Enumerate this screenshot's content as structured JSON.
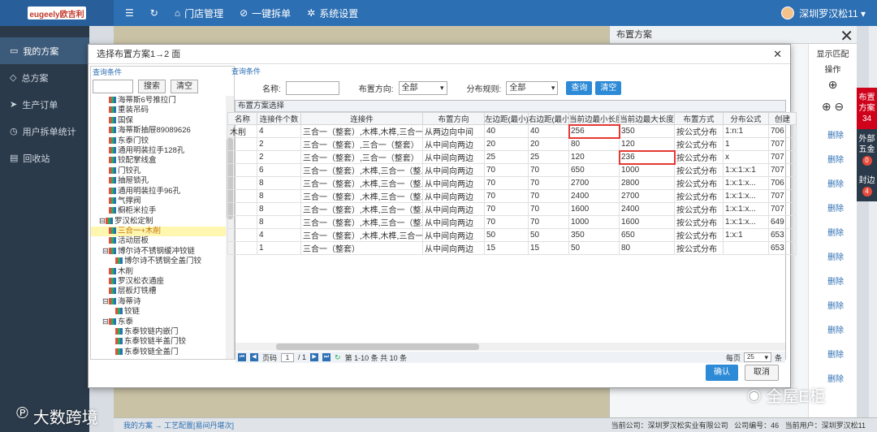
{
  "app": {
    "logo_text": "eugeely欧吉利",
    "nav": [
      {
        "label": "门店管理",
        "icon": "home-icon"
      },
      {
        "label": "一键拆单",
        "icon": "check-circle-icon"
      },
      {
        "label": "系统设置",
        "icon": "gear-icon"
      }
    ],
    "user": "深圳罗汉松11 ▾"
  },
  "sidebar": {
    "items": [
      {
        "label": "我的方案",
        "active": true
      },
      {
        "label": "总方案"
      },
      {
        "label": "生产订单"
      },
      {
        "label": "用户拆单统计"
      },
      {
        "label": "回收站"
      }
    ]
  },
  "right_panel": {
    "title": "布置方案",
    "show_match": "显示匹配",
    "col_head": "操作",
    "delete": "删除",
    "tabs": [
      {
        "label": "布置方案",
        "count": "34"
      },
      {
        "label": "外部五金",
        "count": "0"
      },
      {
        "label": "封边",
        "count": "4"
      }
    ]
  },
  "footer": {
    "breadcrumb": "我的方案 → 工艺配置[易间丹堪次]",
    "company": "当前公司：深圳罗汉松实业有限公司",
    "code": "公司编号：46",
    "user": "当前用户：深圳罗汉松11"
  },
  "modal": {
    "title": "选择布置方案1→2 面",
    "left": {
      "query_label": "查询条件",
      "search_btn": "搜索",
      "clear_btn": "清空",
      "tree": [
        "海蒂斯6号推拉门",
        "重装吊码",
        "国保",
        "海蒂斯抽屉89089626",
        "东泰门铰",
        "通用明装拉手128孔",
        "铰配掌线盒",
        "门铰孔",
        "抽屉锁孔",
        "通用明装拉手96孔",
        "气撑阀",
        "橱柜米拉手",
        "罗汉松定制",
        "三合一+木削",
        "活动层板",
        "博尔诗不锈钢缓冲铰链",
        "博尔诗不锈钢全盖门铰",
        "木削",
        "罗汉松衣通座",
        "层板灯铣槽",
        "海蒂诗",
        "铰链",
        "东泰",
        "东泰铰链内嵌门",
        "东泰铰链半盖门铰",
        "东泰铰链全盖门"
      ]
    },
    "query": {
      "label": "查询条件",
      "name_label": "名称:",
      "direction_label": "布置方向:",
      "direction_value": "全部",
      "rule_label": "分布规则:",
      "rule_value": "全部",
      "query_btn": "查询",
      "clear_btn": "清空"
    },
    "grid": {
      "caption": "布置方案选择",
      "headers": [
        "名称",
        "连接件个数",
        "连接件",
        "布置方向",
        "左边距(最小)",
        "右边距(最小)",
        "当前边最小长度",
        "当前边最大长度",
        "布置方式",
        "分布公式",
        "创建"
      ],
      "rows": [
        [
          "木削",
          "4",
          "三合一（整套）,木榫,木榫,三合一...",
          "从两边向中间",
          "40",
          "40",
          "256",
          "350",
          "按公式分布",
          "1:n:1",
          "706"
        ],
        [
          "",
          "2",
          "三合一（整套）,三合一（整套）",
          "从中间向两边",
          "20",
          "20",
          "80",
          "120",
          "按公式分布",
          "1",
          "707"
        ],
        [
          "",
          "2",
          "三合一（整套）,三合一（整套）",
          "从中间向两边",
          "25",
          "25",
          "120",
          "236",
          "按公式分布",
          "x",
          "707"
        ],
        [
          "",
          "6",
          "三合一（整套）,木榫,三合一（整...",
          "从中间向两边",
          "70",
          "70",
          "650",
          "1000",
          "按公式分布",
          "1:x:1:x:1",
          "707"
        ],
        [
          "",
          "8",
          "三合一（整套）,木榫,三合一（整...",
          "从中间向两边",
          "70",
          "70",
          "2700",
          "2800",
          "按公式分布",
          "1:x:1:x...",
          "706"
        ],
        [
          "",
          "8",
          "三合一（整套）,木榫,三合一（整...",
          "从中间向两边",
          "70",
          "70",
          "2400",
          "2700",
          "按公式分布",
          "1:x:1:x...",
          "707"
        ],
        [
          "",
          "8",
          "三合一（整套）,木榫,三合一（整...",
          "从中间向两边",
          "70",
          "70",
          "1600",
          "2400",
          "按公式分布",
          "1:x:1:x...",
          "707"
        ],
        [
          "",
          "8",
          "三合一（整套）,木榫,三合一（整...",
          "从中间向两边",
          "70",
          "70",
          "1000",
          "1600",
          "按公式分布",
          "1:x:1:x...",
          "649"
        ],
        [
          "",
          "4",
          "三合一（整套）,木榫,木榫,三合一...",
          "从中间向两边",
          "50",
          "50",
          "350",
          "650",
          "按公式分布",
          "1:x:1",
          "653"
        ],
        [
          "",
          "1",
          "三合一（整套）",
          "从中间向两边",
          "15",
          "15",
          "50",
          "80",
          "按公式分布",
          "",
          "653"
        ]
      ]
    },
    "pager": {
      "page_label": "页码",
      "page": "1",
      "total": "/ 1",
      "summary": "第 1-10 条  共 10 条",
      "per_page_label": "每页",
      "per_page": "25",
      "unit": "条"
    },
    "ok_btn": "确认",
    "cancel_btn": "取消"
  },
  "watermark": {
    "right": "全屋E柜",
    "left": "大数跨境"
  }
}
